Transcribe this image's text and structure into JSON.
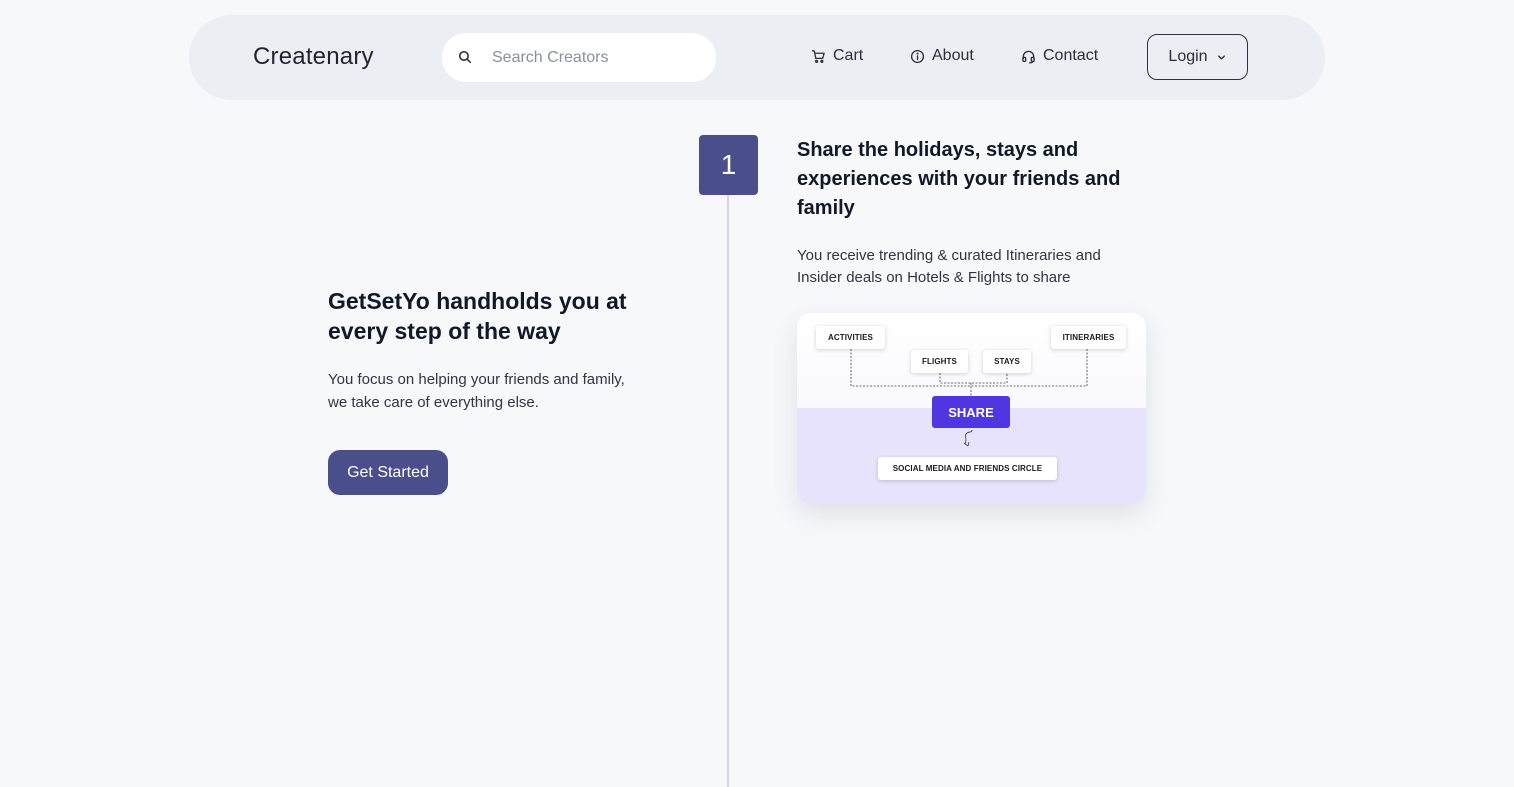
{
  "navbar": {
    "brand": "Createnary",
    "search": {
      "placeholder": "Search Creators",
      "value": "",
      "icon": "search-icon"
    },
    "links": [
      {
        "label": "Cart",
        "icon": "cart-icon"
      },
      {
        "label": "About",
        "icon": "info-icon"
      },
      {
        "label": "Contact",
        "icon": "headset-icon"
      }
    ],
    "login": {
      "label": "Login",
      "icon": "chevron-down-icon"
    }
  },
  "hero": {
    "title": "GetSetYo handholds you at every step of the way",
    "description": "You focus on helping your friends and family, we take care of everything else.",
    "cta_label": "Get Started"
  },
  "step": {
    "number": "1",
    "title": "Share the holidays, stays and experiences with your friends and family",
    "description": "You receive trending & curated Itineraries and Insider deals on Hotels & Flights to share"
  },
  "illustration": {
    "tags": {
      "activities": "ACTIVITIES",
      "itineraries": "ITINERARIES",
      "flights": "FLIGHTS",
      "stays": "STAYS",
      "social": "SOCIAL MEDIA AND FRIENDS CIRCLE"
    },
    "share_label": "SHARE"
  },
  "colors": {
    "accent": "#4a4f8c",
    "share": "#5036e0",
    "navbar_bg": "#ebeef3",
    "page_bg": "#f6f8fa"
  }
}
